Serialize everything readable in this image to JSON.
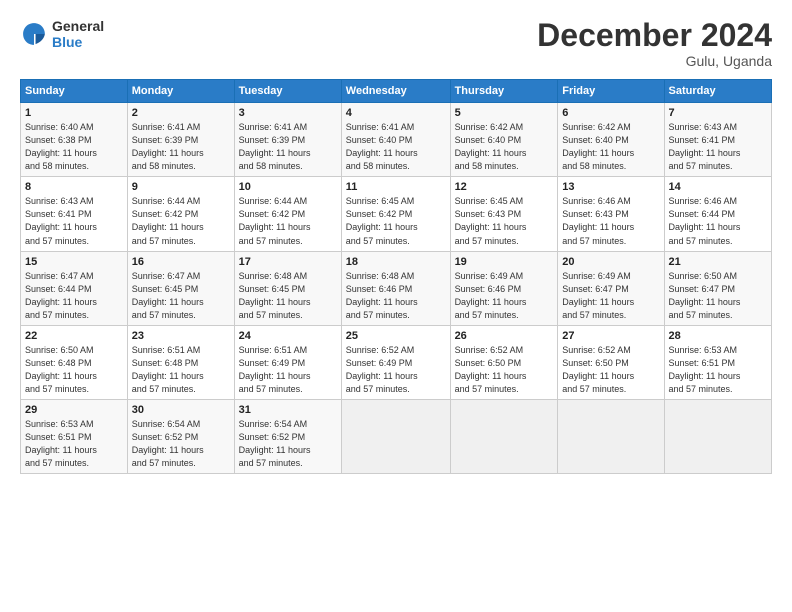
{
  "logo": {
    "line1": "General",
    "line2": "Blue"
  },
  "title": "December 2024",
  "subtitle": "Gulu, Uganda",
  "days_of_week": [
    "Sunday",
    "Monday",
    "Tuesday",
    "Wednesday",
    "Thursday",
    "Friday",
    "Saturday"
  ],
  "weeks": [
    [
      {
        "day": "1",
        "info": "Sunrise: 6:40 AM\nSunset: 6:38 PM\nDaylight: 11 hours\nand 58 minutes."
      },
      {
        "day": "2",
        "info": "Sunrise: 6:41 AM\nSunset: 6:39 PM\nDaylight: 11 hours\nand 58 minutes."
      },
      {
        "day": "3",
        "info": "Sunrise: 6:41 AM\nSunset: 6:39 PM\nDaylight: 11 hours\nand 58 minutes."
      },
      {
        "day": "4",
        "info": "Sunrise: 6:41 AM\nSunset: 6:40 PM\nDaylight: 11 hours\nand 58 minutes."
      },
      {
        "day": "5",
        "info": "Sunrise: 6:42 AM\nSunset: 6:40 PM\nDaylight: 11 hours\nand 58 minutes."
      },
      {
        "day": "6",
        "info": "Sunrise: 6:42 AM\nSunset: 6:40 PM\nDaylight: 11 hours\nand 58 minutes."
      },
      {
        "day": "7",
        "info": "Sunrise: 6:43 AM\nSunset: 6:41 PM\nDaylight: 11 hours\nand 57 minutes."
      }
    ],
    [
      {
        "day": "8",
        "info": "Sunrise: 6:43 AM\nSunset: 6:41 PM\nDaylight: 11 hours\nand 57 minutes."
      },
      {
        "day": "9",
        "info": "Sunrise: 6:44 AM\nSunset: 6:42 PM\nDaylight: 11 hours\nand 57 minutes."
      },
      {
        "day": "10",
        "info": "Sunrise: 6:44 AM\nSunset: 6:42 PM\nDaylight: 11 hours\nand 57 minutes."
      },
      {
        "day": "11",
        "info": "Sunrise: 6:45 AM\nSunset: 6:42 PM\nDaylight: 11 hours\nand 57 minutes."
      },
      {
        "day": "12",
        "info": "Sunrise: 6:45 AM\nSunset: 6:43 PM\nDaylight: 11 hours\nand 57 minutes."
      },
      {
        "day": "13",
        "info": "Sunrise: 6:46 AM\nSunset: 6:43 PM\nDaylight: 11 hours\nand 57 minutes."
      },
      {
        "day": "14",
        "info": "Sunrise: 6:46 AM\nSunset: 6:44 PM\nDaylight: 11 hours\nand 57 minutes."
      }
    ],
    [
      {
        "day": "15",
        "info": "Sunrise: 6:47 AM\nSunset: 6:44 PM\nDaylight: 11 hours\nand 57 minutes."
      },
      {
        "day": "16",
        "info": "Sunrise: 6:47 AM\nSunset: 6:45 PM\nDaylight: 11 hours\nand 57 minutes."
      },
      {
        "day": "17",
        "info": "Sunrise: 6:48 AM\nSunset: 6:45 PM\nDaylight: 11 hours\nand 57 minutes."
      },
      {
        "day": "18",
        "info": "Sunrise: 6:48 AM\nSunset: 6:46 PM\nDaylight: 11 hours\nand 57 minutes."
      },
      {
        "day": "19",
        "info": "Sunrise: 6:49 AM\nSunset: 6:46 PM\nDaylight: 11 hours\nand 57 minutes."
      },
      {
        "day": "20",
        "info": "Sunrise: 6:49 AM\nSunset: 6:47 PM\nDaylight: 11 hours\nand 57 minutes."
      },
      {
        "day": "21",
        "info": "Sunrise: 6:50 AM\nSunset: 6:47 PM\nDaylight: 11 hours\nand 57 minutes."
      }
    ],
    [
      {
        "day": "22",
        "info": "Sunrise: 6:50 AM\nSunset: 6:48 PM\nDaylight: 11 hours\nand 57 minutes."
      },
      {
        "day": "23",
        "info": "Sunrise: 6:51 AM\nSunset: 6:48 PM\nDaylight: 11 hours\nand 57 minutes."
      },
      {
        "day": "24",
        "info": "Sunrise: 6:51 AM\nSunset: 6:49 PM\nDaylight: 11 hours\nand 57 minutes."
      },
      {
        "day": "25",
        "info": "Sunrise: 6:52 AM\nSunset: 6:49 PM\nDaylight: 11 hours\nand 57 minutes."
      },
      {
        "day": "26",
        "info": "Sunrise: 6:52 AM\nSunset: 6:50 PM\nDaylight: 11 hours\nand 57 minutes."
      },
      {
        "day": "27",
        "info": "Sunrise: 6:52 AM\nSunset: 6:50 PM\nDaylight: 11 hours\nand 57 minutes."
      },
      {
        "day": "28",
        "info": "Sunrise: 6:53 AM\nSunset: 6:51 PM\nDaylight: 11 hours\nand 57 minutes."
      }
    ],
    [
      {
        "day": "29",
        "info": "Sunrise: 6:53 AM\nSunset: 6:51 PM\nDaylight: 11 hours\nand 57 minutes."
      },
      {
        "day": "30",
        "info": "Sunrise: 6:54 AM\nSunset: 6:52 PM\nDaylight: 11 hours\nand 57 minutes."
      },
      {
        "day": "31",
        "info": "Sunrise: 6:54 AM\nSunset: 6:52 PM\nDaylight: 11 hours\nand 57 minutes."
      },
      {
        "day": "",
        "info": ""
      },
      {
        "day": "",
        "info": ""
      },
      {
        "day": "",
        "info": ""
      },
      {
        "day": "",
        "info": ""
      }
    ]
  ]
}
